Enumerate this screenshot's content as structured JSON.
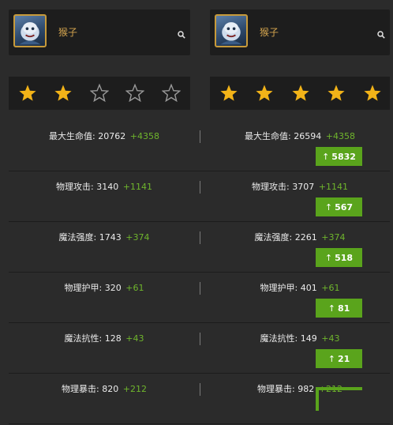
{
  "heroes": [
    {
      "name": "猴子",
      "icon": "hero-portrait",
      "stars_filled": 2,
      "stars_total": 5
    },
    {
      "name": "猴子",
      "icon": "hero-portrait",
      "stars_filled": 5,
      "stars_total": 5
    }
  ],
  "colors": {
    "star": "#f2b318",
    "bonus": "#6fb52c",
    "delta_bg": "#5aa41c",
    "name": "#d3a44e"
  },
  "stats": [
    {
      "label": "最大生命值:",
      "left_value": "20762",
      "left_bonus": "+4358",
      "right_value": "26594",
      "right_bonus": "+4358",
      "delta": "5832"
    },
    {
      "label": "物理攻击:",
      "left_value": "3140",
      "left_bonus": "+1141",
      "right_value": "3707",
      "right_bonus": "+1141",
      "delta": "567"
    },
    {
      "label": "魔法强度:",
      "left_value": "1743",
      "left_bonus": "+374",
      "right_value": "2261",
      "right_bonus": "+374",
      "delta": "518"
    },
    {
      "label": "物理护甲:",
      "left_value": "320",
      "left_bonus": "+61",
      "right_value": "401",
      "right_bonus": "+61",
      "delta": "81"
    },
    {
      "label": "魔法抗性:",
      "left_value": "128",
      "left_bonus": "+43",
      "right_value": "149",
      "right_bonus": "+43",
      "delta": "21"
    },
    {
      "label": "物理暴击:",
      "left_value": "820",
      "left_bonus": "+212",
      "right_value": "982",
      "right_bonus": "+212",
      "delta": ""
    }
  ],
  "delta_arrow": "↑"
}
